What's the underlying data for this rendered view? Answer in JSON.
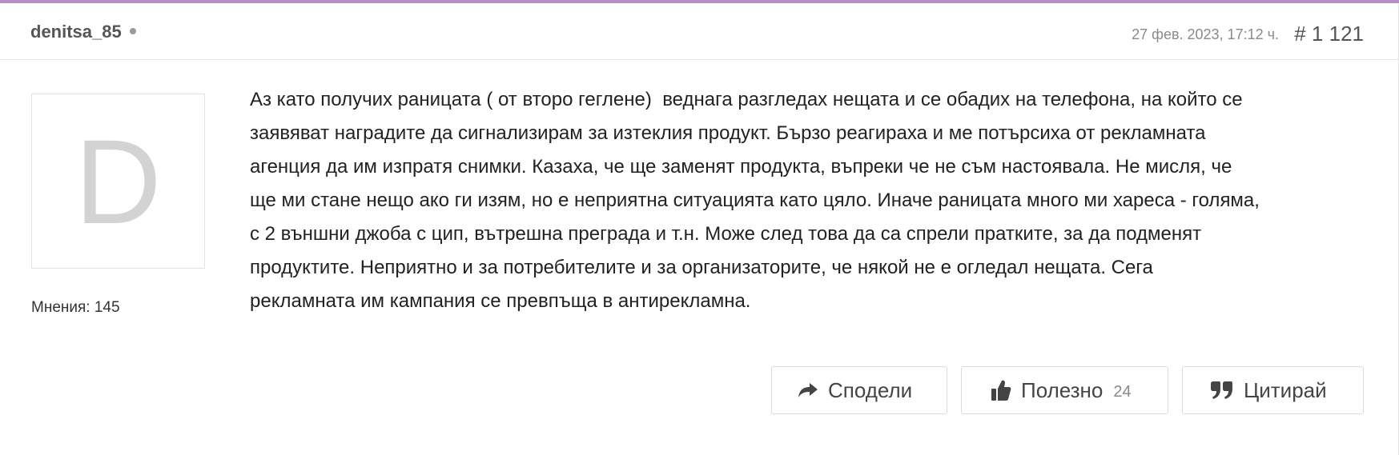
{
  "post": {
    "username": "denitsa_85",
    "date": "27 фев. 2023, 17:12 ч.",
    "number": "# 1 121",
    "avatar_letter": "D",
    "opinions_count": "Мнения: 145",
    "body": "Аз като получих раницата ( от второ геглене)  веднага разгледах нещата и се обадих на телефона, на който се\nзаявяват наградите да сигнализирам за изтеклия продукт. Бързо реагираха и ме потърсиха от рекламната\nагенция да им изпратя снимки. Казаха, че ще заменят продукта, въпреки че не съм настоявала. Не мисля, че\nще ми стане нещо ако ги изям, но е неприятна ситуацията като цяло. Иначе раницата много ми хареса - голяма,\nс 2 външни джоба с цип, вътрешна преграда и т.н. Може след това да са спрели пратките, за да подменят\nпродуктите. Неприятно и за потребителите и за организаторите, че някой не е огледал нещата. Сега\nрекламната им кампания се превпъща в антирекламна."
  },
  "actions": {
    "share_label": "Сподели",
    "useful_label": "Полезно",
    "useful_count": "24",
    "quote_label": "Цитирай"
  },
  "icons": {
    "status": "status-dot-icon",
    "share": "share-arrow-icon",
    "useful": "thumbs-up-icon",
    "quote": "quote-icon"
  },
  "colors": {
    "accent_bar": "#b68fc4",
    "avatar_letter": "#d3d3d3",
    "muted_text": "#8a8a8a"
  }
}
